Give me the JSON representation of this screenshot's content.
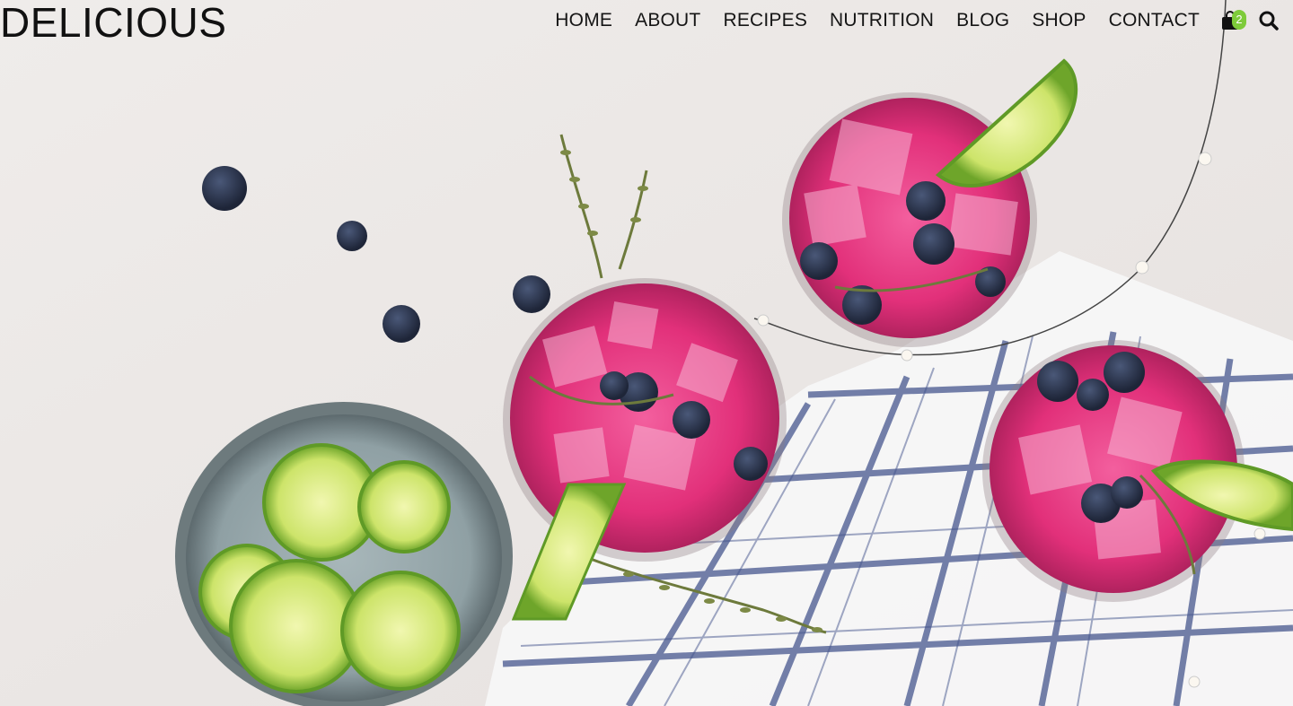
{
  "site": {
    "logo": "DELICIOUS"
  },
  "nav": {
    "items": [
      {
        "label": "HOME",
        "name": "nav-home"
      },
      {
        "label": "ABOUT",
        "name": "nav-about"
      },
      {
        "label": "RECIPES",
        "name": "nav-recipes"
      },
      {
        "label": "NUTRITION",
        "name": "nav-nutrition"
      },
      {
        "label": "BLOG",
        "name": "nav-blog"
      },
      {
        "label": "SHOP",
        "name": "nav-shop"
      },
      {
        "label": "CONTACT",
        "name": "nav-contact"
      }
    ],
    "cart_count": "2",
    "cart_icon": "shopping-bag-icon",
    "search_icon": "search-icon"
  },
  "colors": {
    "background": "#ece8e6",
    "accent_badge": "#7ecb3a",
    "text": "#151515",
    "drink": "#e0327a",
    "lime": "#a5d64a",
    "blueberry": "#2f3a56"
  }
}
